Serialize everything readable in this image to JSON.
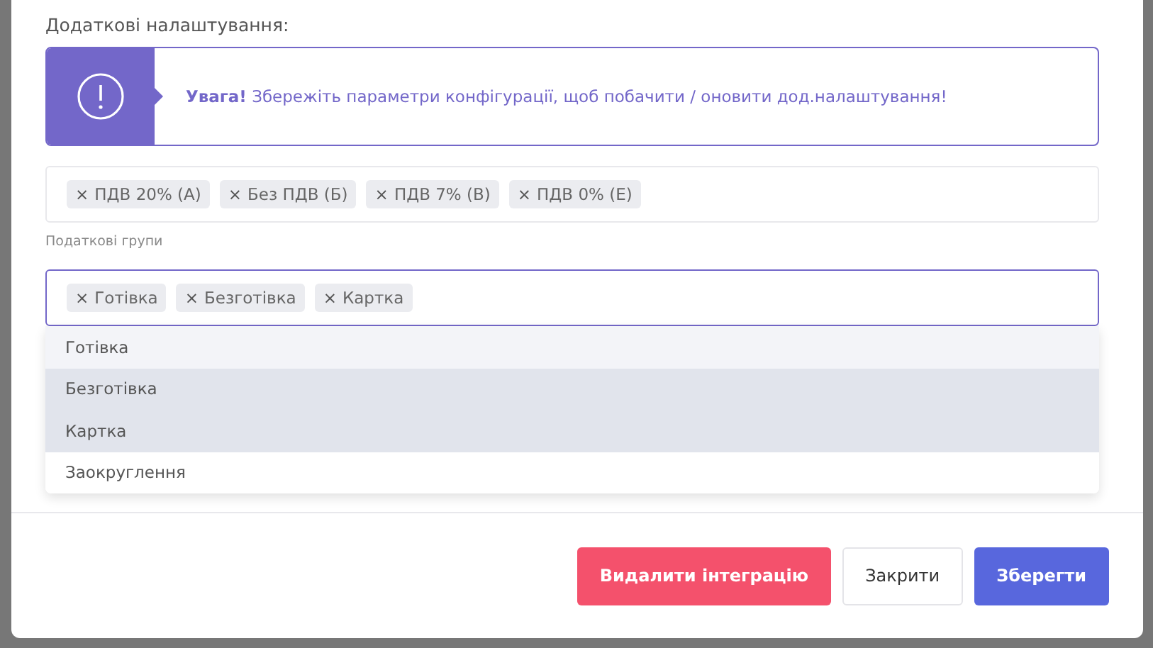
{
  "section_title": "Додаткові налаштування:",
  "alert": {
    "text": "**Увага!** Збережіть параметри конфігурації, щоб побачити / оновити дод.налаштування!"
  },
  "tax_groups": {
    "label": "Податкові групи",
    "tags": [
      {
        "remove": "×",
        "text": "ПДВ 20% (А)"
      },
      {
        "remove": "×",
        "text": "Без ПДВ (Б)"
      },
      {
        "remove": "×",
        "text": "ПДВ 7% (В)"
      },
      {
        "remove": "×",
        "text": "ПДВ 0% (Е)"
      }
    ]
  },
  "payment_types": {
    "focused": true,
    "tags": [
      {
        "remove": "×",
        "text": "Готівка"
      },
      {
        "remove": "×",
        "text": "Безготівка"
      },
      {
        "remove": "×",
        "text": "Картка"
      }
    ],
    "options": [
      {
        "label": "Готівка",
        "selected": true,
        "highlighted": true
      },
      {
        "label": "Безготівка",
        "selected": true,
        "highlighted": false
      },
      {
        "label": "Картка",
        "selected": true,
        "highlighted": false
      },
      {
        "label": "Заокруглення",
        "selected": false,
        "highlighted": false
      }
    ]
  },
  "buttons": [
    {
      "kind": "danger",
      "label": "Видалити інтеграцію"
    },
    {
      "kind": "secondary",
      "label": "Закрити"
    },
    {
      "kind": "primary",
      "label": "Зберегти"
    }
  ]
}
